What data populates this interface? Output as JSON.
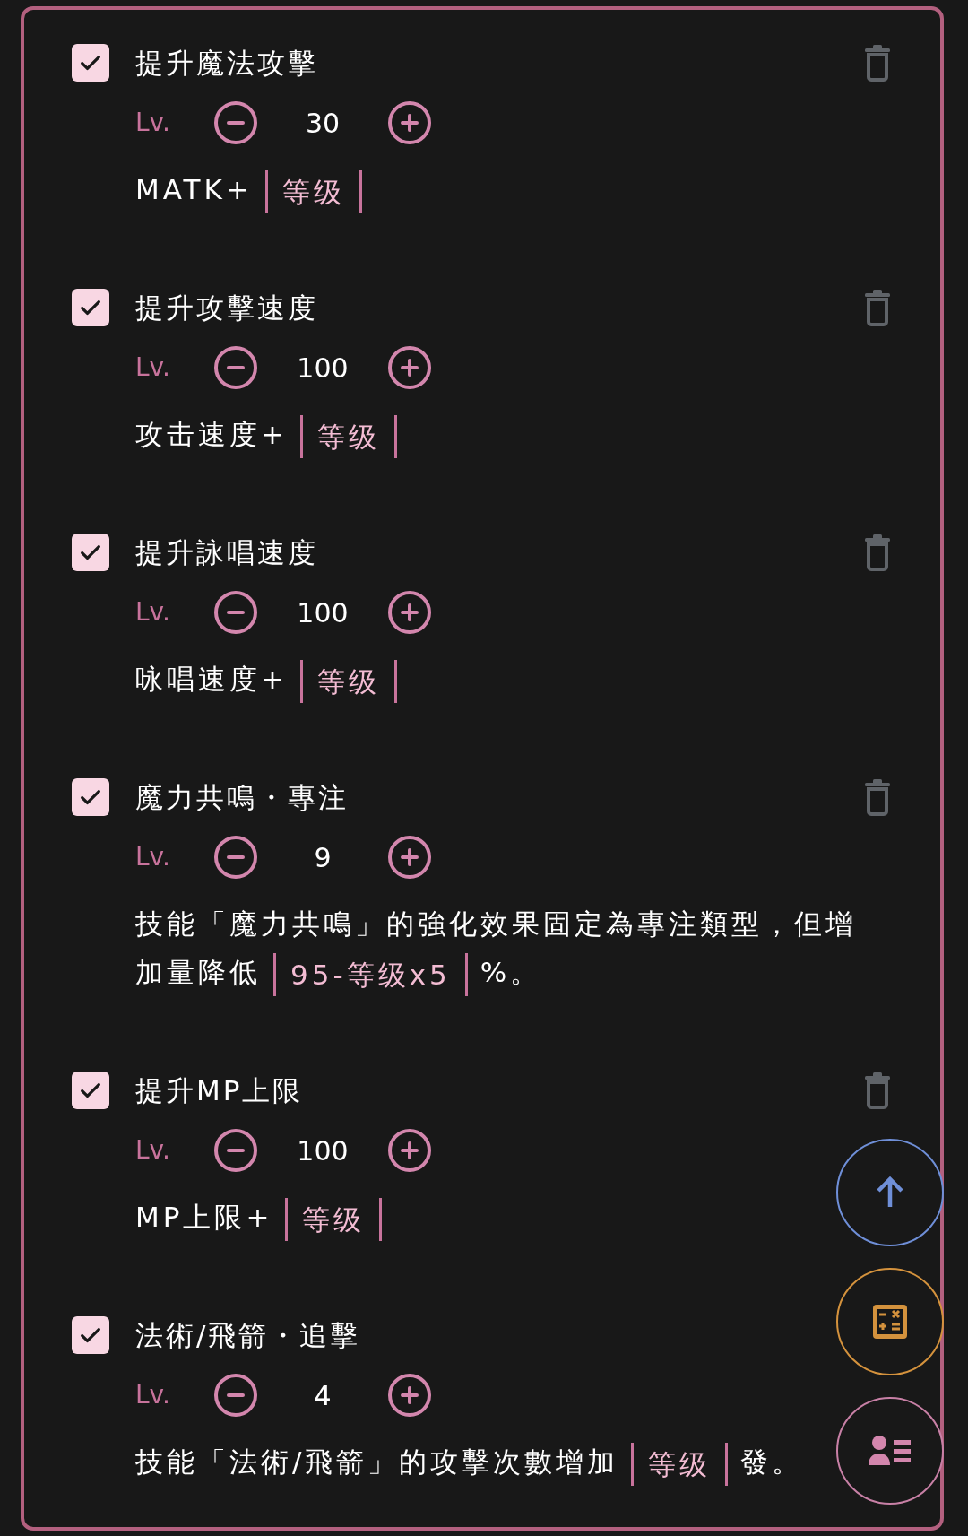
{
  "skills": [
    {
      "name": "提升魔法攻擊",
      "checked": true,
      "delete_button": true,
      "level_label": "Lv.",
      "value": "30",
      "effect": [
        {
          "kind": "text",
          "text": "MATK+"
        },
        {
          "kind": "formula",
          "text": "等级"
        }
      ]
    },
    {
      "name": "提升攻擊速度",
      "checked": true,
      "delete_button": true,
      "level_label": "Lv.",
      "value": "100",
      "effect": [
        {
          "kind": "text",
          "text": "攻击速度+"
        },
        {
          "kind": "formula",
          "text": "等级"
        }
      ]
    },
    {
      "name": "提升詠唱速度",
      "checked": true,
      "delete_button": true,
      "level_label": "Lv.",
      "value": "100",
      "effect": [
        {
          "kind": "text",
          "text": "咏唱速度+"
        },
        {
          "kind": "formula",
          "text": "等级"
        }
      ]
    },
    {
      "name": "魔力共鳴・專注",
      "checked": true,
      "delete_button": true,
      "level_label": "Lv.",
      "value": "9",
      "effect": [
        {
          "kind": "text",
          "text": "技能「魔力共鳴」的強化效果固定為專注類型，但增加量降低"
        },
        {
          "kind": "formula",
          "text": "95-等级x5"
        },
        {
          "kind": "text",
          "text": "%。"
        }
      ]
    },
    {
      "name": "提升MP上限",
      "checked": true,
      "delete_button": true,
      "level_label": "Lv.",
      "value": "100",
      "effect": [
        {
          "kind": "text",
          "text": "MP上限+"
        },
        {
          "kind": "formula",
          "text": "等级"
        }
      ]
    },
    {
      "name": "法術/飛箭・追擊",
      "checked": true,
      "delete_button": false,
      "level_label": "Lv.",
      "value": "4",
      "effect": [
        {
          "kind": "text",
          "text": "技能「法術/飛箭」的攻擊次數增加"
        },
        {
          "kind": "formula",
          "text": "等级"
        },
        {
          "kind": "text",
          "text": "發。"
        }
      ]
    }
  ]
}
